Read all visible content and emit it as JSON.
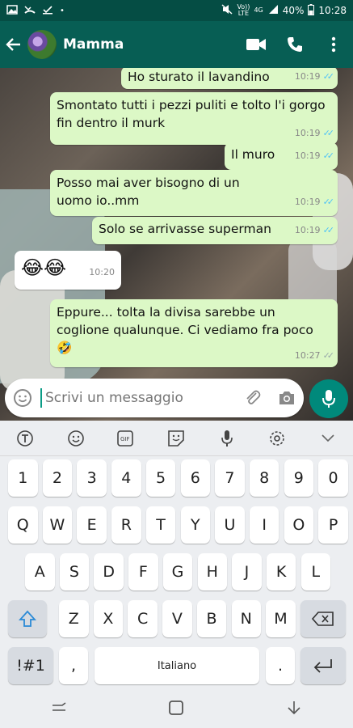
{
  "statusbar": {
    "left_icons": [
      "image-icon",
      "missed-call-icon",
      "check-icon",
      "dot-icon"
    ],
    "volte_top": "Vo))",
    "volte_bottom": "LTE",
    "network": "4G",
    "battery": "40%",
    "time": "10:28"
  },
  "header": {
    "contact_name": "Mamma"
  },
  "messages": [
    {
      "text": "Ho sturato il lavandino",
      "time": "10:19",
      "dir": "out",
      "status": "read"
    },
    {
      "text": "Smontato tutti i pezzi puliti e tolto l'i gorgo fin dentro il murk",
      "time": "10:19",
      "dir": "out",
      "status": "read"
    },
    {
      "text": "Il muro",
      "time": "10:19",
      "dir": "out",
      "status": "read"
    },
    {
      "text": "Posso mai aver bisogno di un uomo io..mm",
      "time": "10:19",
      "dir": "out",
      "status": "read"
    },
    {
      "text": "Solo se arrivasse superman",
      "time": "10:19",
      "dir": "out",
      "status": "read"
    },
    {
      "text": "😂😂",
      "time": "10:20",
      "dir": "in"
    },
    {
      "text": "Eppure... tolta la divisa sarebbe un coglione qualunque. Ci vediamo fra poco 🤣",
      "time": "10:27",
      "dir": "out",
      "status": "delivered"
    }
  ],
  "input": {
    "placeholder": "Scrivi un messaggio"
  },
  "keyboard": {
    "row_numbers": [
      "1",
      "2",
      "3",
      "4",
      "5",
      "6",
      "7",
      "8",
      "9",
      "0"
    ],
    "row_q": [
      "Q",
      "W",
      "E",
      "R",
      "T",
      "Y",
      "U",
      "I",
      "O",
      "P"
    ],
    "row_a": [
      "A",
      "S",
      "D",
      "F",
      "G",
      "H",
      "J",
      "K",
      "L"
    ],
    "row_z": [
      "Z",
      "X",
      "C",
      "V",
      "B",
      "N",
      "M"
    ],
    "symbols_key": "!#1",
    "comma_key": ",",
    "space_label": "Italiano",
    "period_key": "."
  },
  "colors": {
    "header": "#075e54",
    "statusbar": "#054d44",
    "outgoing_bubble": "#dcf8c6",
    "incoming_bubble": "#ffffff",
    "read_ticks": "#4fc3f7",
    "mic_button": "#00897b"
  }
}
